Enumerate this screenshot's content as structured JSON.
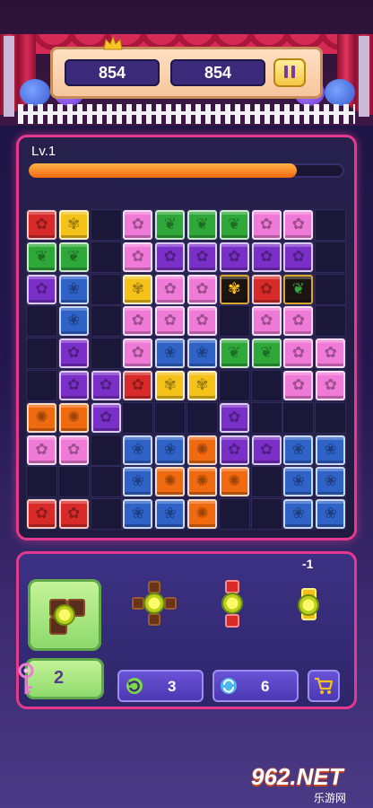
{
  "header": {
    "score_left": "854",
    "score_right": "854",
    "pause_icon": "pause-icon",
    "crown_icon": "crown-icon"
  },
  "level": {
    "label": "Lv.1",
    "progress": 0.85
  },
  "colors": {
    "red": "#d92a2a",
    "yellow": "#f5c21a",
    "green": "#2fa83a",
    "purple": "#7a2fc8",
    "blue": "#2f63c8",
    "pink": "#f07ad8",
    "orange": "#f06a10",
    "gold_frame": "#d9a630"
  },
  "board": {
    "rows": 10,
    "cols": 10,
    "grid": [
      [
        "r",
        "y",
        "",
        "p",
        "g",
        "g",
        "g",
        "p",
        "p",
        ""
      ],
      [
        "g",
        "g",
        "",
        "p",
        "v",
        "v",
        "v",
        "v",
        "v",
        ""
      ],
      [
        "v",
        "b",
        "",
        "y",
        "p",
        "p",
        "Y",
        "r",
        "G",
        ""
      ],
      [
        "",
        "b",
        "",
        "p",
        "p",
        "p",
        "",
        "p",
        "p",
        ""
      ],
      [
        "",
        "v",
        "",
        "p",
        "b",
        "b",
        "g",
        "g",
        "p",
        "p"
      ],
      [
        "",
        "v",
        "v",
        "r",
        "y",
        "y",
        "",
        "",
        "p",
        "p"
      ],
      [
        "o",
        "o",
        "v",
        "",
        "",
        "",
        "v",
        "",
        "",
        ""
      ],
      [
        "p",
        "p",
        "",
        "b",
        "b",
        "o",
        "v",
        "v",
        "b",
        "b"
      ],
      [
        "",
        "",
        "",
        "b",
        "o",
        "o",
        "o",
        "",
        "b",
        "b"
      ],
      [
        "r",
        "r",
        "",
        "b",
        "b",
        "o",
        "",
        "",
        "b",
        "b"
      ]
    ]
  },
  "tray": {
    "minus_label": "-1",
    "rotate_icon": "rotate-icon",
    "key_icon": "key-icon",
    "key_count": "2",
    "tools": [
      {
        "icon": "undo-icon",
        "count": "3"
      },
      {
        "icon": "refresh-icon",
        "count": "6"
      }
    ],
    "shop_icon": "cart-icon"
  },
  "watermark": {
    "main": "962.NET",
    "sub": "乐游网"
  }
}
